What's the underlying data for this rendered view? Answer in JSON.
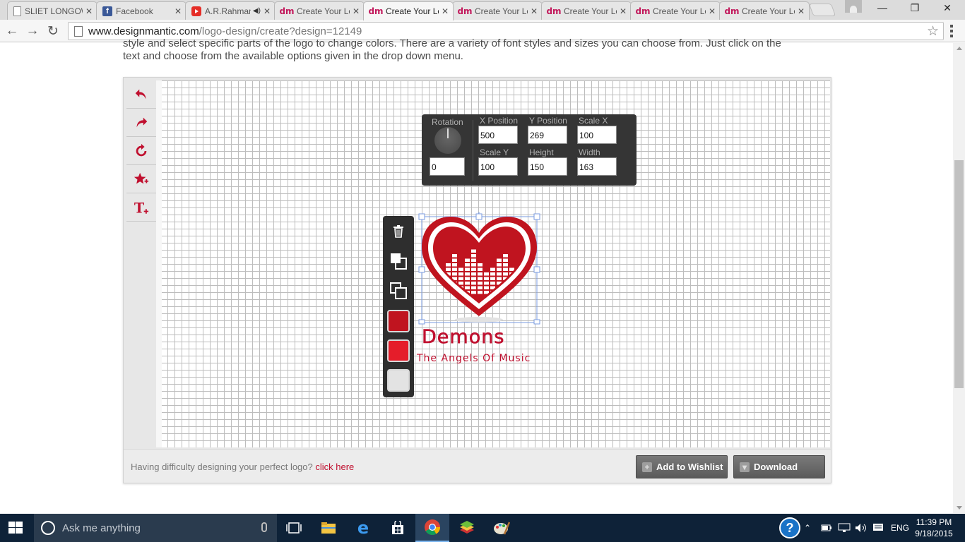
{
  "browser": {
    "tabs": [
      {
        "icon": "doc",
        "title": "SLIET LONGOWAL",
        "active": false
      },
      {
        "icon": "fb",
        "title": "Facebook",
        "active": false
      },
      {
        "icon": "yt",
        "title": "A.R.Rahman",
        "active": false
      },
      {
        "icon": "dm",
        "title": "Create Your Logo",
        "active": false
      },
      {
        "icon": "dm",
        "title": "Create Your Logo",
        "active": true
      },
      {
        "icon": "dm",
        "title": "Create Your Logo",
        "active": false
      },
      {
        "icon": "dm",
        "title": "Create Your Logo",
        "active": false
      },
      {
        "icon": "dm",
        "title": "Create Your Logo",
        "active": false
      },
      {
        "icon": "dm",
        "title": "Create Your Logo",
        "active": false
      }
    ],
    "url_host": "www.designmantic.com",
    "url_path": "/logo-design/create?design=12149"
  },
  "page": {
    "intro_line1": "style and select specific parts of the logo to change colors. There are a variety of font styles and sizes you can choose from. Just click on the",
    "intro_line2": "text and choose from the available options given in the drop down menu.",
    "help_text": "Having difficulty designing your perfect logo?",
    "help_link": "click here",
    "wishlist_label": "Add to Wishlist",
    "download_label": "Download"
  },
  "props": {
    "rotation_label": "Rotation",
    "rotation_value": "0",
    "x_label": "X Position",
    "x_value": "500",
    "y_label": "Y Position",
    "y_value": "269",
    "scalex_label": "Scale X",
    "scalex_value": "100",
    "scaley_label": "Scale Y",
    "scaley_value": "100",
    "height_label": "Height",
    "height_value": "150",
    "width_label": "Width",
    "width_value": "163"
  },
  "swatches": [
    "#c0141f",
    "#e51d2a",
    "#e3e3e3"
  ],
  "logo": {
    "name": "Demons",
    "tagline": "The Angels Of Music",
    "color": "#c0102f"
  },
  "taskbar": {
    "search_placeholder": "Ask me anything",
    "language": "ENG",
    "time": "11:39 PM",
    "date": "9/18/2015"
  }
}
